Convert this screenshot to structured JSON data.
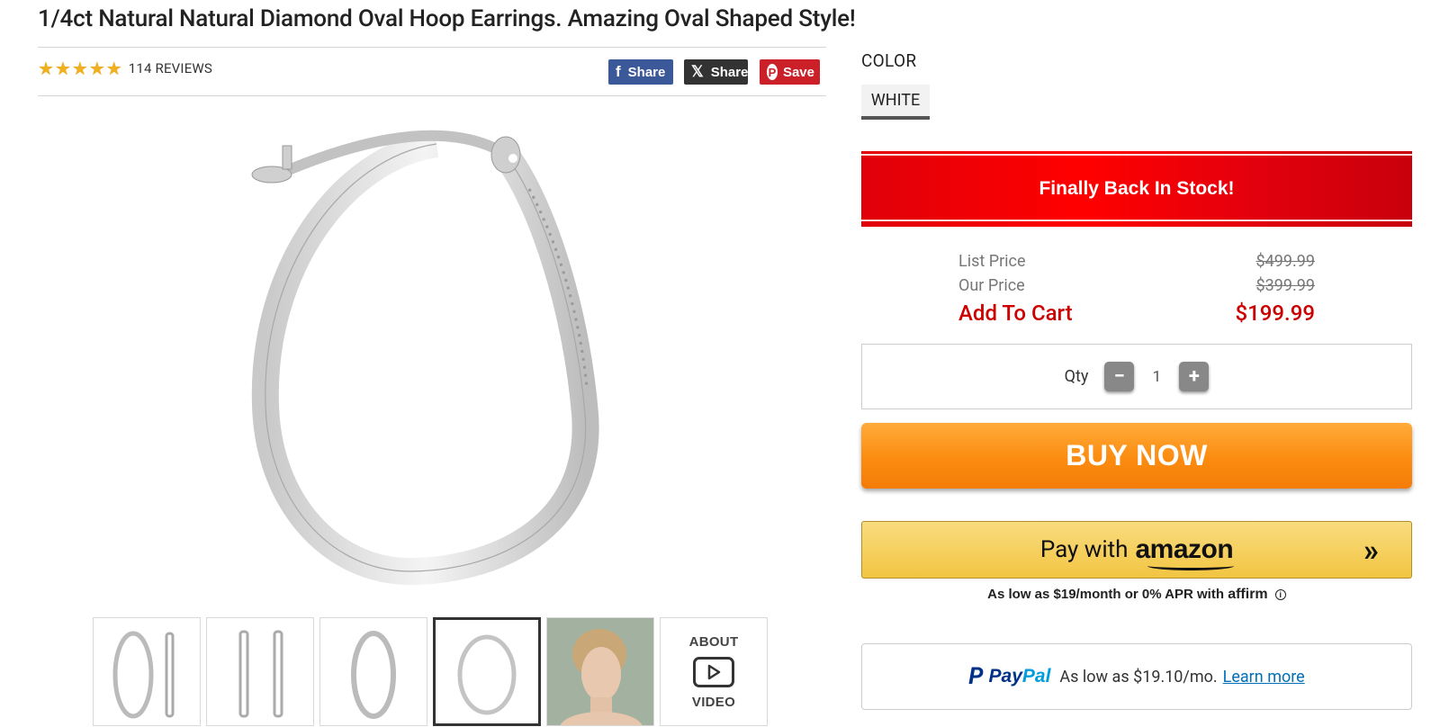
{
  "product": {
    "title": "1/4ct Natural Natural Diamond Oval Hoop Earrings. Amazing Oval Shaped Style!",
    "rating": 5,
    "reviews_label": "114 REVIEWS"
  },
  "social": {
    "facebook_label": "Share",
    "x_label": "Share",
    "pinterest_label": "Save"
  },
  "gallery": {
    "thumbnails": [
      "Earring pair side view",
      "Earring side profile",
      "Earring oval angle",
      "Earring oval front",
      "Model wearing earrings"
    ],
    "active_index": 3,
    "video_top": "ABOUT",
    "video_bottom": "VIDEO"
  },
  "options": {
    "color_label": "COLOR",
    "selected_color": "WHITE"
  },
  "stock_banner": "Finally Back In Stock!",
  "pricing": {
    "list_label": "List Price",
    "list_value": "$499.99",
    "our_label": "Our Price",
    "our_value": "$399.99",
    "cart_label": "Add To Cart",
    "cart_value": "$199.99"
  },
  "quantity": {
    "label": "Qty",
    "value": "1",
    "minus": "−",
    "plus": "+"
  },
  "buy_now_label": "BUY NOW",
  "amazon_pay": {
    "prefix": "Pay with",
    "brand": "amazon",
    "chevron": "»"
  },
  "affirm": {
    "text": "As low as $19/month or 0% APR with",
    "brand": "affirm",
    "info": "i"
  },
  "paypal": {
    "brand_part1": "Pay",
    "brand_part2": "Pal",
    "text": "As low as $19.10/mo.",
    "link": "Learn more"
  },
  "colors": {
    "stock_red": "#ff0000",
    "buy_orange": "#fb8c10",
    "amazon_yellow": "#f2c542",
    "price_red": "#cc0000",
    "star": "#f2b01e"
  }
}
